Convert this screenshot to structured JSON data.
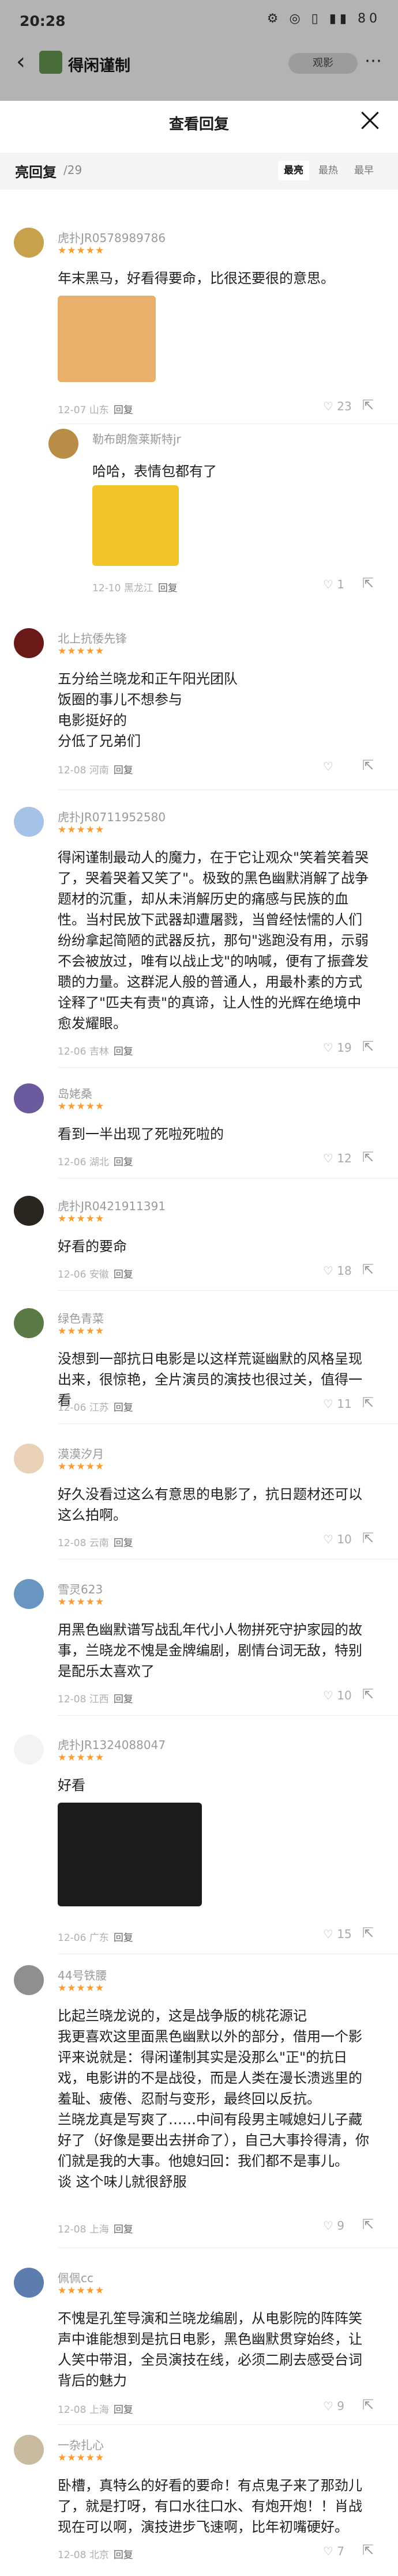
{
  "status_bar": {
    "time": "20:28",
    "icons": "⚙ ◎ ▯ ▮▮ 80"
  },
  "app_header": {
    "title": "得闲谨制",
    "pill": "观影"
  },
  "sheet": {
    "title": "查看回复",
    "label": "亮回复",
    "count": "/29",
    "sort_options": [
      "最亮",
      "最热",
      "最早"
    ]
  },
  "comments": [
    {
      "user": "虎扑JR0578989786",
      "stars": "★★★★★",
      "text": "年末黑马，好看得要命，比很还要很的意思。",
      "time": "12-07",
      "loc": "山东",
      "reply": "回复",
      "likes": "23"
    },
    {
      "user": "勒布朗詹莱斯特jr",
      "stars": "",
      "text": "哈哈，表情包都有了",
      "time": "12-10",
      "loc": "黑龙江",
      "reply": "回复",
      "likes": "1"
    },
    {
      "user": "北上抗倭先锋",
      "stars": "★★★★★",
      "text": "五分给兰晓龙和正午阳光团队\n饭圈的事儿不想参与\n电影挺好的\n分低了兄弟们",
      "time": "12-08",
      "loc": "河南",
      "reply": "回复",
      "likes": ""
    },
    {
      "user": "虎扑JR0711952580",
      "stars": "★★★★★",
      "text": "得闲谨制最动人的魔力，在于它让观众\"笑着笑着哭了，哭着哭着又笑了\"。极致的黑色幽默消解了战争题材的沉重，却从未消解历史的痛感与民族的血性。当村民放下武器却遭屠戮，当曾经怯懦的人们纷纷拿起简陋的武器反抗，那句\"逃跑没有用，示弱不会被放过，唯有以战止戈\"的呐喊，便有了振聋发聩的力量。这群泥人般的普通人，用最朴素的方式诠释了\"匹夫有责\"的真谛，让人性的光辉在绝境中愈发耀眼。",
      "time": "12-06",
      "loc": "吉林",
      "reply": "回复",
      "likes": "19"
    },
    {
      "user": "岛姥桑",
      "stars": "★★★★★",
      "text": "看到一半出现了死啦死啦的",
      "time": "12-06",
      "loc": "湖北",
      "reply": "回复",
      "likes": "12"
    },
    {
      "user": "虎扑JR0421911391",
      "stars": "★★★★★",
      "text": "好看的要命",
      "time": "12-06",
      "loc": "安徽",
      "reply": "回复",
      "likes": "18"
    },
    {
      "user": "绿色青菜",
      "stars": "★★★★★",
      "text": "没想到一部抗日电影是以这样荒诞幽默的风格呈现出来，很惊艳，全片演员的演技也很过关，值得一看",
      "time": "12-06",
      "loc": "江苏",
      "reply": "回复",
      "likes": "11"
    },
    {
      "user": "漠漠汐月",
      "stars": "★★★★★",
      "text": "好久没看过这么有意思的电影了，抗日题材还可以这么拍啊。",
      "time": "12-08",
      "loc": "云南",
      "reply": "回复",
      "likes": "10"
    },
    {
      "user": "雪灵623",
      "stars": "★★★★★",
      "text": "用黑色幽默谱写战乱年代小人物拼死守护家园的故事，兰晓龙不愧是金牌编剧，剧情台词无敌，特别是配乐太喜欢了",
      "time": "12-08",
      "loc": "江西",
      "reply": "回复",
      "likes": "10"
    },
    {
      "user": "虎扑JR1324088047",
      "stars": "★★★★★",
      "text": "好看",
      "time": "12-06",
      "loc": "广东",
      "reply": "回复",
      "likes": "15"
    },
    {
      "user": "44号铁腰",
      "stars": "★★★★★",
      "text": "比起兰晓龙说的，这是战争版的桃花源记\n我更喜欢这里面黑色幽默以外的部分，借用一个影评来说就是：得闲谨制其实是没那么\"正\"的抗日戏，电影讲的不是战役，而是人类在漫长溃逃里的羞耻、疲倦、忍耐与变形，最终回以反抗。\n兰晓龙真是写爽了……中间有段男主喊媳妇儿子藏好了（好像是要出去拼命了），自己大事拎得清，你们就是我的大事。他媳妇回：我们都不是事儿。\n谈 这个味儿就很舒服",
      "time": "12-08",
      "loc": "上海",
      "reply": "回复",
      "likes": "9"
    },
    {
      "user": "佩佩cc",
      "stars": "★★★★★",
      "text": "不愧是孔笙导演和兰晓龙编剧，从电影院的阵阵笑声中谁能想到是抗日电影，黑色幽默贯穿始终，让人笑中带泪，全员演技在线，必须二刷去感受台词背后的魅力",
      "time": "12-08",
      "loc": "上海",
      "reply": "回复",
      "likes": "9"
    },
    {
      "user": "一杂扎心",
      "stars": "★★★★★",
      "text": "卧槽，真特么的好看的要命！有点鬼子来了那劲儿了，就是打呀，有口水往口水、有炮开炮！！肖战现在可以啊，演技进步飞速啊，比年初嘴硬好。",
      "time": "12-08",
      "loc": "北京",
      "reply": "回复",
      "likes": "7"
    }
  ]
}
